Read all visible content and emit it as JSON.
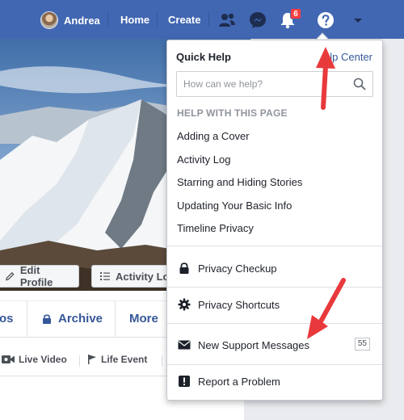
{
  "topbar": {
    "user_name": "Andrea",
    "home": "Home",
    "create": "Create",
    "notification_count": "6",
    "icons": [
      "friend-requests-icon",
      "messenger-icon",
      "notifications-bell-icon",
      "help-question-icon",
      "caret-down-icon"
    ]
  },
  "profile": {
    "buttons": {
      "edit_profile": "Edit Profile",
      "activity_log": "Activity Lo"
    },
    "tabs": {
      "photos_partial": "os",
      "archive": "Archive",
      "more": "More"
    },
    "composer": {
      "live_video": "Live Video",
      "life_event": "Life Event"
    }
  },
  "menu": {
    "title": "Quick Help",
    "help_center": "lp Center",
    "search_placeholder": "How can we help?",
    "section_heading": "HELP WITH THIS PAGE",
    "help_items": [
      "Adding a Cover",
      "Activity Log",
      "Starring and Hiding Stories",
      "Updating Your Basic Info",
      "Timeline Privacy"
    ],
    "privacy_checkup": "Privacy Checkup",
    "privacy_shortcuts": "Privacy Shortcuts",
    "support_messages": "New Support Messages",
    "support_count": "55",
    "report_problem": "Report a Problem"
  },
  "colors": {
    "header_blue": "#4267b2",
    "link_blue": "#365899",
    "arrow_red": "#e8393c",
    "badge_red": "#fa3e3e"
  }
}
